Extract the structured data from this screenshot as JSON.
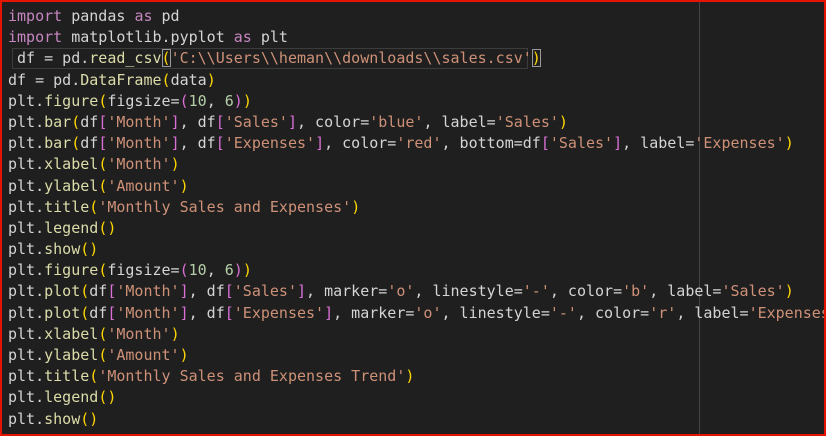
{
  "editor": {
    "language": "python",
    "colors": {
      "background": "#1f1f1f",
      "frame_border": "#e51400",
      "keyword": "#c586c0",
      "text": "#d4d4d4",
      "function": "#dcdcaa",
      "string": "#ce9178",
      "number": "#b5cea8",
      "bracket_level_1": "#ffd700",
      "bracket_level_2": "#da70d6",
      "bracket_level_3": "#179fff"
    },
    "lines": [
      [
        [
          "kw",
          "import"
        ],
        [
          "tx",
          " pandas "
        ],
        [
          "kw",
          "as"
        ],
        [
          "tx",
          " pd"
        ]
      ],
      [
        [
          "kw",
          "import"
        ],
        [
          "tx",
          " matplotlib.pyplot "
        ],
        [
          "kw",
          "as"
        ],
        [
          "tx",
          " plt"
        ]
      ],
      [
        [
          "tx",
          " df = pd."
        ],
        [
          "fn",
          "read_csv"
        ],
        [
          "b1",
          "("
        ],
        [
          "st",
          "'C:\\\\Users\\\\heman\\\\downloads\\\\sales.csv'"
        ],
        [
          "b1",
          ")"
        ]
      ],
      [
        [
          "tx",
          "df = pd."
        ],
        [
          "fn",
          "DataFrame"
        ],
        [
          "b1",
          "("
        ],
        [
          "tx",
          "data"
        ],
        [
          "b1",
          ")"
        ]
      ],
      [
        [
          "tx",
          "plt."
        ],
        [
          "fn",
          "figure"
        ],
        [
          "b1",
          "("
        ],
        [
          "tx",
          "figsize="
        ],
        [
          "b2",
          "("
        ],
        [
          "nm",
          "10"
        ],
        [
          "tx",
          ", "
        ],
        [
          "nm",
          "6"
        ],
        [
          "b2",
          ")"
        ],
        [
          "b1",
          ")"
        ]
      ],
      [
        [
          "tx",
          "plt."
        ],
        [
          "fn",
          "bar"
        ],
        [
          "b1",
          "("
        ],
        [
          "tx",
          "df"
        ],
        [
          "b2",
          "["
        ],
        [
          "st",
          "'Month'"
        ],
        [
          "b2",
          "]"
        ],
        [
          "tx",
          ", df"
        ],
        [
          "b2",
          "["
        ],
        [
          "st",
          "'Sales'"
        ],
        [
          "b2",
          "]"
        ],
        [
          "tx",
          ", color="
        ],
        [
          "st",
          "'blue'"
        ],
        [
          "tx",
          ", label="
        ],
        [
          "st",
          "'Sales'"
        ],
        [
          "b1",
          ")"
        ]
      ],
      [
        [
          "tx",
          "plt."
        ],
        [
          "fn",
          "bar"
        ],
        [
          "b1",
          "("
        ],
        [
          "tx",
          "df"
        ],
        [
          "b2",
          "["
        ],
        [
          "st",
          "'Month'"
        ],
        [
          "b2",
          "]"
        ],
        [
          "tx",
          ", df"
        ],
        [
          "b2",
          "["
        ],
        [
          "st",
          "'Expenses'"
        ],
        [
          "b2",
          "]"
        ],
        [
          "tx",
          ", color="
        ],
        [
          "st",
          "'red'"
        ],
        [
          "tx",
          ", bottom=df"
        ],
        [
          "b2",
          "["
        ],
        [
          "st",
          "'Sales'"
        ],
        [
          "b2",
          "]"
        ],
        [
          "tx",
          ", label="
        ],
        [
          "st",
          "'Expenses'"
        ],
        [
          "b1",
          ")"
        ]
      ],
      [
        [
          "tx",
          "plt."
        ],
        [
          "fn",
          "xlabel"
        ],
        [
          "b1",
          "("
        ],
        [
          "st",
          "'Month'"
        ],
        [
          "b1",
          ")"
        ]
      ],
      [
        [
          "tx",
          "plt."
        ],
        [
          "fn",
          "ylabel"
        ],
        [
          "b1",
          "("
        ],
        [
          "st",
          "'Amount'"
        ],
        [
          "b1",
          ")"
        ]
      ],
      [
        [
          "tx",
          "plt."
        ],
        [
          "fn",
          "title"
        ],
        [
          "b1",
          "("
        ],
        [
          "st",
          "'Monthly Sales and Expenses'"
        ],
        [
          "b1",
          ")"
        ]
      ],
      [
        [
          "tx",
          "plt."
        ],
        [
          "fn",
          "legend"
        ],
        [
          "b1",
          "()"
        ]
      ],
      [
        [
          "tx",
          "plt."
        ],
        [
          "fn",
          "show"
        ],
        [
          "b1",
          "()"
        ]
      ],
      [
        [
          "tx",
          "plt."
        ],
        [
          "fn",
          "figure"
        ],
        [
          "b1",
          "("
        ],
        [
          "tx",
          "figsize="
        ],
        [
          "b2",
          "("
        ],
        [
          "nm",
          "10"
        ],
        [
          "tx",
          ", "
        ],
        [
          "nm",
          "6"
        ],
        [
          "b2",
          ")"
        ],
        [
          "b1",
          ")"
        ]
      ],
      [
        [
          "tx",
          "plt."
        ],
        [
          "fn",
          "plot"
        ],
        [
          "b1",
          "("
        ],
        [
          "tx",
          "df"
        ],
        [
          "b2",
          "["
        ],
        [
          "st",
          "'Month'"
        ],
        [
          "b2",
          "]"
        ],
        [
          "tx",
          ", df"
        ],
        [
          "b2",
          "["
        ],
        [
          "st",
          "'Sales'"
        ],
        [
          "b2",
          "]"
        ],
        [
          "tx",
          ", marker="
        ],
        [
          "st",
          "'o'"
        ],
        [
          "tx",
          ", linestyle="
        ],
        [
          "st",
          "'-'"
        ],
        [
          "tx",
          ", color="
        ],
        [
          "st",
          "'b'"
        ],
        [
          "tx",
          ", label="
        ],
        [
          "st",
          "'Sales'"
        ],
        [
          "b1",
          ")"
        ]
      ],
      [
        [
          "tx",
          "plt."
        ],
        [
          "fn",
          "plot"
        ],
        [
          "b1",
          "("
        ],
        [
          "tx",
          "df"
        ],
        [
          "b2",
          "["
        ],
        [
          "st",
          "'Month'"
        ],
        [
          "b2",
          "]"
        ],
        [
          "tx",
          ", df"
        ],
        [
          "b2",
          "["
        ],
        [
          "st",
          "'Expenses'"
        ],
        [
          "b2",
          "]"
        ],
        [
          "tx",
          ", marker="
        ],
        [
          "st",
          "'o'"
        ],
        [
          "tx",
          ", linestyle="
        ],
        [
          "st",
          "'-'"
        ],
        [
          "tx",
          ", color="
        ],
        [
          "st",
          "'r'"
        ],
        [
          "tx",
          ", label="
        ],
        [
          "st",
          "'Expenses'"
        ],
        [
          "b1",
          ")"
        ]
      ],
      [
        [
          "tx",
          "plt."
        ],
        [
          "fn",
          "xlabel"
        ],
        [
          "b1",
          "("
        ],
        [
          "st",
          "'Month'"
        ],
        [
          "b1",
          ")"
        ]
      ],
      [
        [
          "tx",
          "plt."
        ],
        [
          "fn",
          "ylabel"
        ],
        [
          "b1",
          "("
        ],
        [
          "st",
          "'Amount'"
        ],
        [
          "b1",
          ")"
        ]
      ],
      [
        [
          "tx",
          "plt."
        ],
        [
          "fn",
          "title"
        ],
        [
          "b1",
          "("
        ],
        [
          "st",
          "'Monthly Sales and Expenses Trend'"
        ],
        [
          "b1",
          ")"
        ]
      ],
      [
        [
          "tx",
          "plt."
        ],
        [
          "fn",
          "legend"
        ],
        [
          "b1",
          "()"
        ]
      ],
      [
        [
          "tx",
          "plt."
        ],
        [
          "fn",
          "show"
        ],
        [
          "b1",
          "()"
        ]
      ]
    ]
  }
}
